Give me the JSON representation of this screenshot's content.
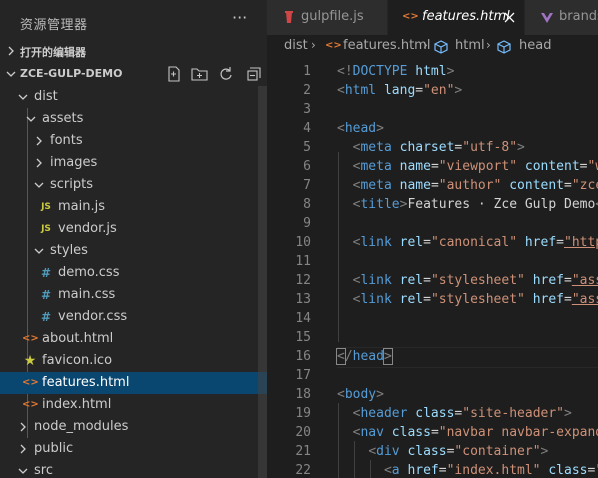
{
  "explorer": {
    "title": "资源管理器",
    "more_icon": "ellipsis-icon",
    "open_editors_label": "打开的编辑器",
    "workspace_label": "ZCE-GULP-DEMO",
    "actions": [
      "new-file-icon",
      "new-folder-icon",
      "refresh-icon",
      "collapse-all-icon"
    ],
    "tree": [
      {
        "label": "dist",
        "type": "folder",
        "open": true,
        "depth": 0
      },
      {
        "label": "assets",
        "type": "folder",
        "open": true,
        "depth": 1
      },
      {
        "label": "fonts",
        "type": "folder",
        "open": false,
        "depth": 2
      },
      {
        "label": "images",
        "type": "folder",
        "open": false,
        "depth": 2
      },
      {
        "label": "scripts",
        "type": "folder",
        "open": true,
        "depth": 2
      },
      {
        "label": "main.js",
        "type": "js",
        "depth": 3,
        "badge": "JS"
      },
      {
        "label": "vendor.js",
        "type": "js",
        "depth": 3,
        "badge": "JS"
      },
      {
        "label": "styles",
        "type": "folder",
        "open": true,
        "depth": 2
      },
      {
        "label": "demo.css",
        "type": "css",
        "depth": 3,
        "badge": "#"
      },
      {
        "label": "main.css",
        "type": "css",
        "depth": 3,
        "badge": "#"
      },
      {
        "label": "vendor.css",
        "type": "css",
        "depth": 3,
        "badge": "#"
      },
      {
        "label": "about.html",
        "type": "html",
        "depth": 1,
        "badge": "<>"
      },
      {
        "label": "favicon.ico",
        "type": "ico",
        "depth": 1,
        "badge": "★"
      },
      {
        "label": "features.html",
        "type": "html",
        "depth": 1,
        "badge": "<>",
        "selected": true
      },
      {
        "label": "index.html",
        "type": "html",
        "depth": 1,
        "badge": "<>"
      },
      {
        "label": "node_modules",
        "type": "folder",
        "open": false,
        "depth": 0
      },
      {
        "label": "public",
        "type": "folder",
        "open": false,
        "depth": 0
      },
      {
        "label": "src",
        "type": "folder",
        "open": true,
        "depth": 0
      }
    ]
  },
  "tabs": [
    {
      "label": "gulpfile.js",
      "icon": "gulp-icon",
      "active": false
    },
    {
      "label": "features.html",
      "icon": "html-icon",
      "active": true,
      "close_icon": "close-icon"
    },
    {
      "label": "brands.",
      "icon": "vue-icon",
      "active": false
    }
  ],
  "breadcrumb": [
    "dist",
    "features.html",
    "html",
    "head"
  ],
  "editor": {
    "line_numbers": [
      "1",
      "2",
      "3",
      "4",
      "5",
      "6",
      "7",
      "8",
      "9",
      "10",
      "11",
      "12",
      "13",
      "14",
      "15",
      "16",
      "17",
      "18",
      "19",
      "20",
      "21",
      "22"
    ]
  },
  "colors": {
    "tag": "#569cd6",
    "attr": "#9cdcfe",
    "string": "#ce9178",
    "selection": "#094771",
    "html_icon": "#e37933",
    "css_icon": "#519aba",
    "js_icon": "#cbcb41",
    "star": "#cbcb41"
  }
}
